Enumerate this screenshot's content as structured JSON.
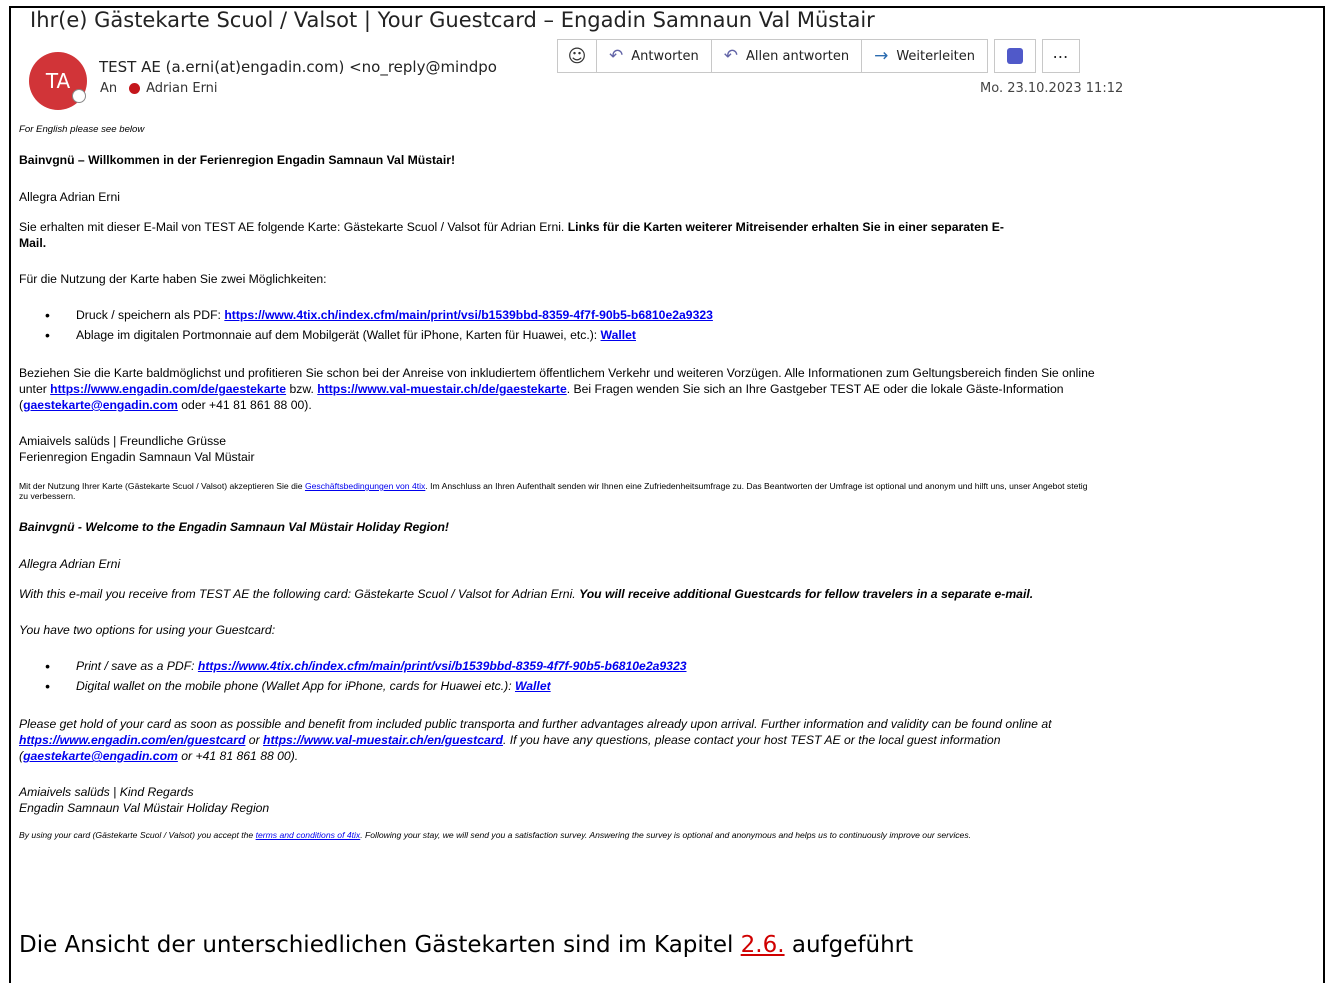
{
  "subject": "Ihr(e) Gästekarte Scuol / Valsot | Your Guestcard – Engadin Samnaun Val Müstair",
  "avatar_initials": "TA",
  "sender": "TEST AE (a.erni(at)engadin.com) <no_reply@mindpo",
  "to_label": "An",
  "recipient": "Adrian Erni",
  "date": "Mo. 23.10.2023 11:12",
  "toolbar": {
    "reply": "Antworten",
    "reply_all": "Allen antworten",
    "forward": "Weiterleiten"
  },
  "de": {
    "for_english": "For English please see below",
    "welcome": "Bainvgnü – Willkommen in der Ferienregion Engadin Samnaun Val Müstair!",
    "greeting": "Allegra Adrian Erni",
    "intro": "Sie erhalten mit dieser E-Mail von TEST AE folgende Karte: Gästekarte Scuol / Valsot für Adrian Erni. ",
    "intro_bold": "Links für die Karten weiterer Mitreisender erhalten Sie in einer separaten E-Mail.",
    "options": "Für die Nutzung der Karte haben Sie zwei Möglichkeiten:",
    "bullet1_prefix": "Druck / speichern als PDF: ",
    "bullet1_link": "https://www.4tix.ch/index.cfm/main/print/vsi/b1539bbd-8359-4f7f-90b5-b6810e2a9323",
    "bullet2_prefix": "Ablage im digitalen Portmonnaie auf dem Mobilgerät (Wallet für iPhone, Karten für Huawei, etc.): ",
    "bullet2_link": "Wallet",
    "para_a": "Beziehen Sie die Karte baldmöglichst und profitieren Sie schon bei der Anreise von inkludiertem öffentlichem Verkehr und weiteren Vorzügen. Alle Informationen zum Geltungsbereich finden Sie online unter ",
    "para_link1": "https://www.engadin.com/de/gaestekarte",
    "para_b": " bzw. ",
    "para_link2": "https://www.val-muestair.ch/de/gaestekarte",
    "para_c": ". Bei Fragen wenden Sie sich an Ihre Gastgeber TEST AE oder die lokale Gäste-Information (",
    "para_link3": "gaestekarte@engadin.com",
    "para_d": " oder +41 81 861 88 00).",
    "closing1": "Amiaivels salüds | Freundliche Grüsse",
    "closing2": "Ferienregion Engadin Samnaun Val Müstair",
    "terms_a": "Mit der Nutzung Ihrer Karte (Gästekarte Scuol / Valsot) akzeptieren Sie die ",
    "terms_link": "Geschäftsbedingungen von 4tix",
    "terms_b": ". Im Anschluss an Ihren Aufenthalt senden wir Ihnen eine Zufriedenheitsumfrage zu. Das Beantworten der Umfrage ist optional und anonym und hilft uns, unser Angebot stetig zu verbessern."
  },
  "en": {
    "welcome": "Bainvgnü - Welcome to the Engadin Samnaun Val Müstair Holiday Region!",
    "greeting": "Allegra Adrian Erni",
    "intro": "With this e-mail you receive from TEST AE the following card: Gästekarte Scuol / Valsot for Adrian Erni. ",
    "intro_bold": "You will receive additional Guestcards for fellow travelers in a separate e-mail.",
    "options": "You have two options for using your Guestcard:",
    "bullet1_prefix": "Print / save as a PDF: ",
    "bullet1_link": "https://www.4tix.ch/index.cfm/main/print/vsi/b1539bbd-8359-4f7f-90b5-b6810e2a9323",
    "bullet2_prefix": "Digital wallet on the mobile phone (Wallet App for iPhone, cards for Huawei etc.): ",
    "bullet2_link": "Wallet",
    "para_a": "Please get hold of your card as soon as possible and benefit from included public transporta and further advantages already upon arrival. Further information and validity can be found online at ",
    "para_link1": "https://www.engadin.com/en/guestcard",
    "para_b": " or ",
    "para_link2": "https://www.val-muestair.ch/en/guestcard",
    "para_c": ". If you have any questions, please contact your host TEST AE or the local guest information (",
    "para_link3": "gaestekarte@engadin.com",
    "para_d": " or +41 81 861 88 00).",
    "closing1": "Amiaivels salüds | Kind Regards",
    "closing2": "Engadin Samnaun Val Müstair Holiday Region",
    "terms_a": "By using your card (Gästekarte Scuol / Valsot) you accept the ",
    "terms_link": "terms and conditions of 4tix",
    "terms_b": ". Following your stay, we will send you a satisfaction survey. Answering the survey is optional and anonymous and helps us to continuously improve our services."
  },
  "caption": {
    "before": "Die Ansicht der unterschiedlichen Gästekarten sind im Kapitel ",
    "ref": "2.6.",
    "after": " aufgeführt"
  }
}
